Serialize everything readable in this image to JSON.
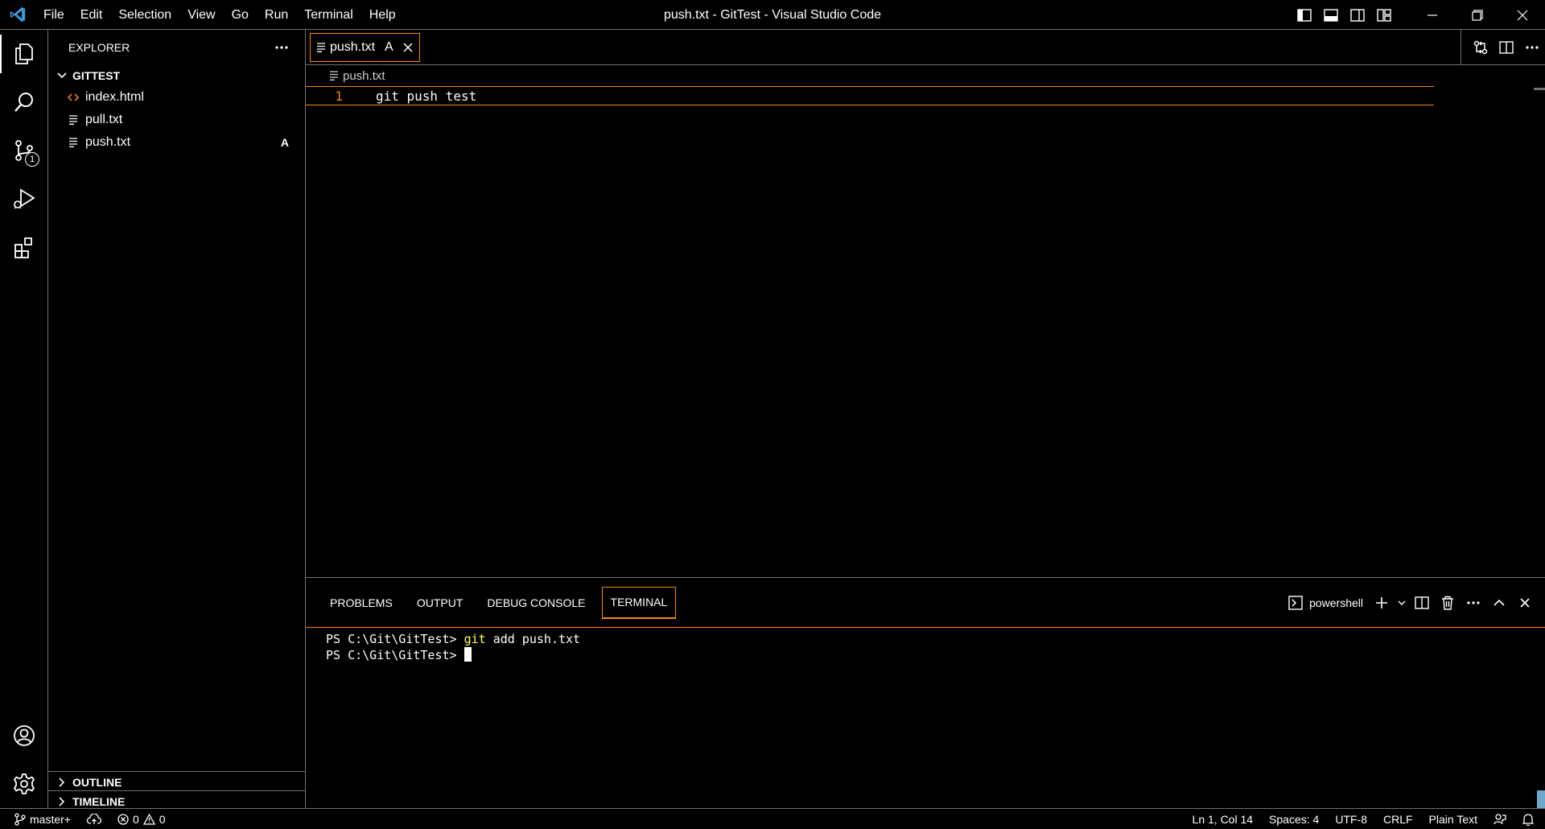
{
  "window": {
    "title": "push.txt - GitTest - Visual Studio Code"
  },
  "menu": {
    "items": [
      "File",
      "Edit",
      "Selection",
      "View",
      "Go",
      "Run",
      "Terminal",
      "Help"
    ]
  },
  "activity": {
    "source_control_badge": "1"
  },
  "sidebar": {
    "title": "EXPLORER",
    "folder": "GITTEST",
    "files": [
      {
        "name": "index.html",
        "icon": "html-file-icon",
        "status": ""
      },
      {
        "name": "pull.txt",
        "icon": "text-file-icon",
        "status": ""
      },
      {
        "name": "push.txt",
        "icon": "text-file-icon",
        "status": "A"
      }
    ],
    "outline": "OUTLINE",
    "timeline": "TIMELINE"
  },
  "editor": {
    "tab": {
      "label": "push.txt",
      "status": "A"
    },
    "breadcrumb": "push.txt",
    "lines": [
      {
        "number": "1",
        "text": "git push test"
      }
    ]
  },
  "panel": {
    "tabs": [
      "PROBLEMS",
      "OUTPUT",
      "DEBUG CONSOLE",
      "TERMINAL"
    ],
    "active_tab": "TERMINAL",
    "shell": "powershell",
    "terminal": [
      {
        "prompt": "PS C:\\Git\\GitTest> ",
        "cmd": "git",
        "args": " add push.txt"
      },
      {
        "prompt": "PS C:\\Git\\GitTest> ",
        "cmd": "",
        "args": ""
      }
    ]
  },
  "status": {
    "branch": "master+",
    "errors": "0",
    "warnings": "0",
    "position": "Ln 1, Col 14",
    "spaces": "Spaces: 4",
    "encoding": "UTF-8",
    "eol": "CRLF",
    "language": "Plain Text"
  },
  "colors": {
    "accent": "#f38518",
    "border": "#6f6f6f",
    "vscode_blue": "#3c99d4",
    "html_icon": "#e37933",
    "terminal_cmd": "#ffff66"
  }
}
